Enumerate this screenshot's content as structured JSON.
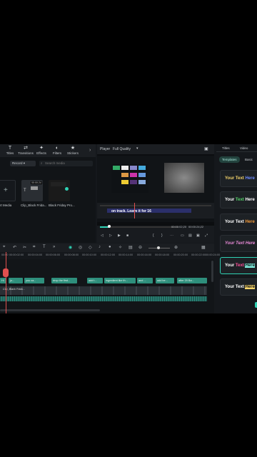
{
  "toolbar": {
    "items": [
      {
        "label": "Titles",
        "icon": "T"
      },
      {
        "label": "Transitions",
        "icon": "⇄"
      },
      {
        "label": "Effects",
        "icon": "✦"
      },
      {
        "label": "Filters",
        "icon": "◐"
      },
      {
        "label": "Stickers",
        "icon": "★"
      }
    ]
  },
  "media": {
    "filter_label": "Record",
    "search_placeholder": "Search media",
    "items": [
      {
        "caption": "rt Media"
      },
      {
        "caption": "Clip_Black Frida..."
      },
      {
        "caption": "Black Friday Pro..."
      }
    ],
    "thumb_duration": "00:00:24"
  },
  "player": {
    "label": "Player",
    "quality": "Full Quality",
    "subtitle": "on track. Leave it for 16",
    "time_current": "00:00:02;20",
    "time_total": "00:00:24;22"
  },
  "right_panel": {
    "tabs": [
      "Titles",
      "Video"
    ],
    "subtabs": [
      "Templates",
      "Basic"
    ],
    "styles": [
      {
        "prefix": "Your ",
        "mid": "Text ",
        "suffix": "Here"
      },
      {
        "prefix": "Your ",
        "mid": "Text ",
        "suffix": "Here"
      },
      {
        "prefix": "Your ",
        "mid": "Text ",
        "suffix": "Here"
      },
      {
        "prefix": "Your ",
        "mid": "Text ",
        "suffix": "Here"
      },
      {
        "prefix": "Your ",
        "mid": "Text ",
        "suffix": "Here"
      },
      {
        "prefix": "Your ",
        "mid": "Text ",
        "suffix": "Here"
      }
    ]
  },
  "timeline": {
    "ruler": [
      "00:00",
      "00:00:02:00",
      "00:00:04:00",
      "00:00:06:00",
      "00:00:08:00",
      "00:00:10:00",
      "00:00:12:00",
      "00:00:14:00",
      "00:00:16:00",
      "00:00:18:00",
      "00:00:20:00",
      "00:00:22:00",
      "00:00:24:00"
    ],
    "clips": [
      "Hi",
      "ju...",
      "you ca...",
      "drop the first...",
      "add t...",
      "ingredient like th...",
      "and ...",
      "add be...",
      "after 20 Ba..."
    ],
    "track_label": "Clip_Black Frida..."
  },
  "colors": {
    "accent": "#2fd1b4",
    "clip": "#2e8f7c",
    "playhead": "#e0504f"
  }
}
